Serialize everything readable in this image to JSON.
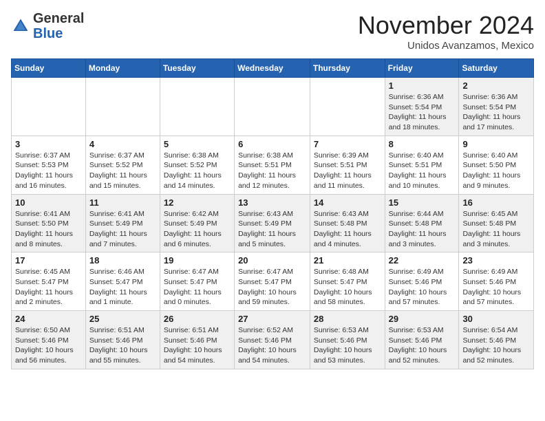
{
  "logo": {
    "general": "General",
    "blue": "Blue"
  },
  "header": {
    "month": "November 2024",
    "location": "Unidos Avanzamos, Mexico"
  },
  "weekdays": [
    "Sunday",
    "Monday",
    "Tuesday",
    "Wednesday",
    "Thursday",
    "Friday",
    "Saturday"
  ],
  "weeks": [
    [
      {
        "day": "",
        "info": ""
      },
      {
        "day": "",
        "info": ""
      },
      {
        "day": "",
        "info": ""
      },
      {
        "day": "",
        "info": ""
      },
      {
        "day": "",
        "info": ""
      },
      {
        "day": "1",
        "info": "Sunrise: 6:36 AM\nSunset: 5:54 PM\nDaylight: 11 hours and 18 minutes."
      },
      {
        "day": "2",
        "info": "Sunrise: 6:36 AM\nSunset: 5:54 PM\nDaylight: 11 hours and 17 minutes."
      }
    ],
    [
      {
        "day": "3",
        "info": "Sunrise: 6:37 AM\nSunset: 5:53 PM\nDaylight: 11 hours and 16 minutes."
      },
      {
        "day": "4",
        "info": "Sunrise: 6:37 AM\nSunset: 5:52 PM\nDaylight: 11 hours and 15 minutes."
      },
      {
        "day": "5",
        "info": "Sunrise: 6:38 AM\nSunset: 5:52 PM\nDaylight: 11 hours and 14 minutes."
      },
      {
        "day": "6",
        "info": "Sunrise: 6:38 AM\nSunset: 5:51 PM\nDaylight: 11 hours and 12 minutes."
      },
      {
        "day": "7",
        "info": "Sunrise: 6:39 AM\nSunset: 5:51 PM\nDaylight: 11 hours and 11 minutes."
      },
      {
        "day": "8",
        "info": "Sunrise: 6:40 AM\nSunset: 5:51 PM\nDaylight: 11 hours and 10 minutes."
      },
      {
        "day": "9",
        "info": "Sunrise: 6:40 AM\nSunset: 5:50 PM\nDaylight: 11 hours and 9 minutes."
      }
    ],
    [
      {
        "day": "10",
        "info": "Sunrise: 6:41 AM\nSunset: 5:50 PM\nDaylight: 11 hours and 8 minutes."
      },
      {
        "day": "11",
        "info": "Sunrise: 6:41 AM\nSunset: 5:49 PM\nDaylight: 11 hours and 7 minutes."
      },
      {
        "day": "12",
        "info": "Sunrise: 6:42 AM\nSunset: 5:49 PM\nDaylight: 11 hours and 6 minutes."
      },
      {
        "day": "13",
        "info": "Sunrise: 6:43 AM\nSunset: 5:49 PM\nDaylight: 11 hours and 5 minutes."
      },
      {
        "day": "14",
        "info": "Sunrise: 6:43 AM\nSunset: 5:48 PM\nDaylight: 11 hours and 4 minutes."
      },
      {
        "day": "15",
        "info": "Sunrise: 6:44 AM\nSunset: 5:48 PM\nDaylight: 11 hours and 3 minutes."
      },
      {
        "day": "16",
        "info": "Sunrise: 6:45 AM\nSunset: 5:48 PM\nDaylight: 11 hours and 3 minutes."
      }
    ],
    [
      {
        "day": "17",
        "info": "Sunrise: 6:45 AM\nSunset: 5:47 PM\nDaylight: 11 hours and 2 minutes."
      },
      {
        "day": "18",
        "info": "Sunrise: 6:46 AM\nSunset: 5:47 PM\nDaylight: 11 hours and 1 minute."
      },
      {
        "day": "19",
        "info": "Sunrise: 6:47 AM\nSunset: 5:47 PM\nDaylight: 11 hours and 0 minutes."
      },
      {
        "day": "20",
        "info": "Sunrise: 6:47 AM\nSunset: 5:47 PM\nDaylight: 10 hours and 59 minutes."
      },
      {
        "day": "21",
        "info": "Sunrise: 6:48 AM\nSunset: 5:47 PM\nDaylight: 10 hours and 58 minutes."
      },
      {
        "day": "22",
        "info": "Sunrise: 6:49 AM\nSunset: 5:46 PM\nDaylight: 10 hours and 57 minutes."
      },
      {
        "day": "23",
        "info": "Sunrise: 6:49 AM\nSunset: 5:46 PM\nDaylight: 10 hours and 57 minutes."
      }
    ],
    [
      {
        "day": "24",
        "info": "Sunrise: 6:50 AM\nSunset: 5:46 PM\nDaylight: 10 hours and 56 minutes."
      },
      {
        "day": "25",
        "info": "Sunrise: 6:51 AM\nSunset: 5:46 PM\nDaylight: 10 hours and 55 minutes."
      },
      {
        "day": "26",
        "info": "Sunrise: 6:51 AM\nSunset: 5:46 PM\nDaylight: 10 hours and 54 minutes."
      },
      {
        "day": "27",
        "info": "Sunrise: 6:52 AM\nSunset: 5:46 PM\nDaylight: 10 hours and 54 minutes."
      },
      {
        "day": "28",
        "info": "Sunrise: 6:53 AM\nSunset: 5:46 PM\nDaylight: 10 hours and 53 minutes."
      },
      {
        "day": "29",
        "info": "Sunrise: 6:53 AM\nSunset: 5:46 PM\nDaylight: 10 hours and 52 minutes."
      },
      {
        "day": "30",
        "info": "Sunrise: 6:54 AM\nSunset: 5:46 PM\nDaylight: 10 hours and 52 minutes."
      }
    ]
  ]
}
